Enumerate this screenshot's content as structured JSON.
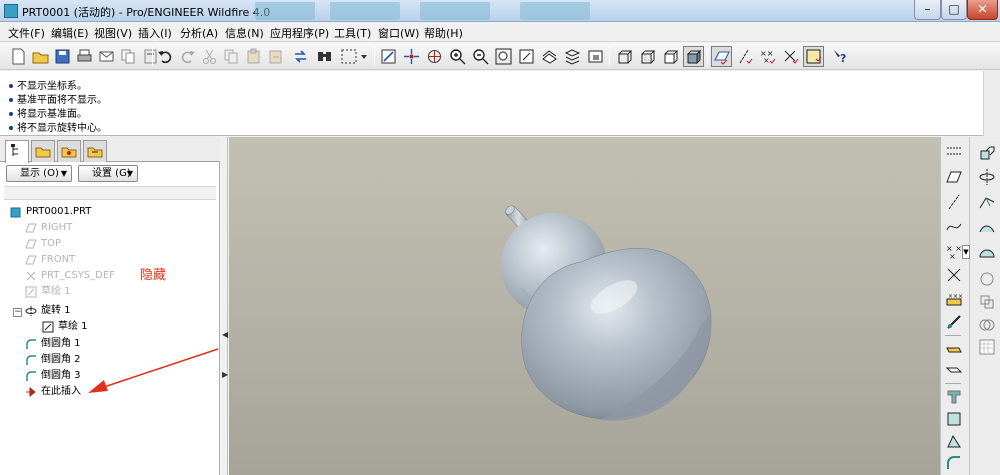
{
  "window": {
    "title": "PRT0001 (活动的) - Pro/ENGINEER Wildfire 4.0",
    "controls": {
      "minimize": "–",
      "maximize": "□",
      "close": "✕"
    }
  },
  "menubar": {
    "items": [
      "文件(F)",
      "编辑(E)",
      "视图(V)",
      "插入(I)",
      "分析(A)",
      "信息(N)",
      "应用程序(P)",
      "工具(T)",
      "窗口(W)",
      "帮助(H)"
    ]
  },
  "toolbar": {
    "icons": [
      "new-icon",
      "open-icon",
      "save-icon",
      "print-icon",
      "send-icon",
      "copy-icon",
      "paste-icon",
      "regenerate-icon",
      "search-icon",
      "select-box-icon",
      "undo-icon",
      "redo-icon",
      "cut-icon",
      "copy2-icon",
      "paste2-icon",
      "paste-special-icon",
      "regen-icon",
      "regen-manager-icon",
      "find-icon",
      "selection-dropdown-icon",
      "redraw-icon",
      "spin-center-icon",
      "orient-icon",
      "zoom-in-icon",
      "zoom-out-icon",
      "refit-icon",
      "reorient-icon",
      "saved-views-icon",
      "layers-icon",
      "view-manager-icon",
      "wireframe-icon",
      "hidden-line-icon",
      "no-hidden-icon",
      "shading-icon",
      "datum-planes-icon",
      "datum-axes-icon",
      "datum-points-icon",
      "coordinate-systems-icon",
      "context-help-icon"
    ]
  },
  "messages": [
    "不显示坐标系。",
    "基准平面将不显示。",
    "将显示基准面。",
    "将不显示旋转中心。"
  ],
  "navigator": {
    "tabs": [
      "model-tree-tab",
      "folder-browser-tab",
      "favorites-tab",
      "connections-tab"
    ],
    "show_button": "显示 (O)",
    "settings_button": "设置 (G)",
    "tree": [
      {
        "label": "PRT0001.PRT",
        "icon": "part-icon",
        "dim": false,
        "indent": 0
      },
      {
        "label": "RIGHT",
        "icon": "datum-plane-icon",
        "dim": true,
        "indent": 1
      },
      {
        "label": "TOP",
        "icon": "datum-plane-icon",
        "dim": true,
        "indent": 1
      },
      {
        "label": "FRONT",
        "icon": "datum-plane-icon",
        "dim": true,
        "indent": 1
      },
      {
        "label": "PRT_CSYS_DEF",
        "icon": "csys-icon",
        "dim": true,
        "indent": 1
      },
      {
        "label": "草绘 1",
        "icon": "sketch-icon",
        "dim": true,
        "indent": 1
      },
      {
        "label": "旋转 1",
        "icon": "revolve-icon",
        "dim": false,
        "indent": 1,
        "expander": "−"
      },
      {
        "label": "草绘 1",
        "icon": "sketch-icon",
        "dim": false,
        "indent": 2
      },
      {
        "label": "倒圆角 1",
        "icon": "round-icon",
        "dim": false,
        "indent": 1
      },
      {
        "label": "倒圆角 2",
        "icon": "round-icon",
        "dim": false,
        "indent": 1
      },
      {
        "label": "倒圆角 3",
        "icon": "round-icon",
        "dim": false,
        "indent": 1
      },
      {
        "label": "在此插入",
        "icon": "insert-here-icon",
        "dim": false,
        "indent": 1
      }
    ],
    "annotation": "隐藏",
    "annotation_color": "#e0321c"
  },
  "rightbar": {
    "col1": [
      "sketch-datum-icon",
      "datum-plane-tool-icon",
      "datum-axis-tool-icon",
      "datum-curve-icon",
      "datum-point-icon",
      "coordinate-system-icon",
      "analysis-feature-icon",
      "insert-shape-icon",
      "hole-icon",
      "shell-icon",
      "rib-icon",
      "draft-icon",
      "round-tool-icon"
    ],
    "col2": [
      "extrude-icon",
      "revolve-tool-icon",
      "sweep-icon",
      "blend-icon",
      "edge-chamfer-icon",
      "mirror-icon",
      "pattern-icon",
      "merge-icon",
      "trim-icon"
    ]
  },
  "colors": {
    "model": "#a9b4bf",
    "background_top": "#c2c0b2",
    "background_bottom": "#a6a49a"
  }
}
